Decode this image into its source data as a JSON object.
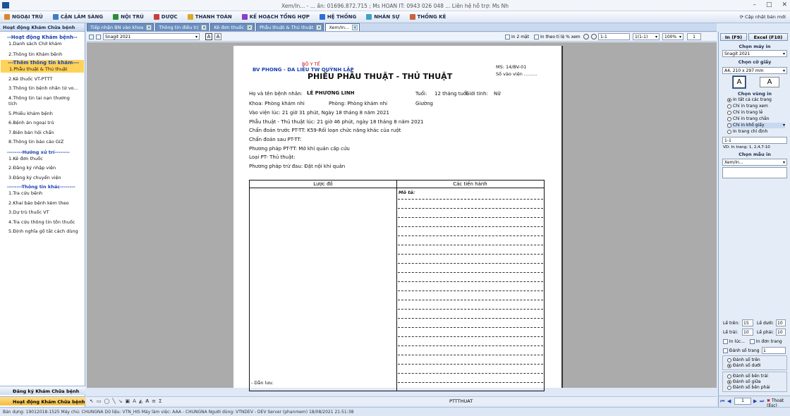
{
  "titlebar": {
    "title": "Xem/In... - ... ần: 01696.872.715 ; Ms HOAN IT: 0943 026 048 ... Liên hệ hỗ trợ: Ms Nh"
  },
  "menu": [
    {
      "label": "NGOẠI TRÚ",
      "color": "#d9862b"
    },
    {
      "label": "CẬN LÂM SÀNG",
      "color": "#3d7cc9"
    },
    {
      "label": "NỘI TRÚ",
      "color": "#2b8c3c"
    },
    {
      "label": "DƯỢC",
      "color": "#c93d3d"
    },
    {
      "label": "THANH TOÁN",
      "color": "#d9a92b"
    },
    {
      "label": "KẾ HOẠCH TỔNG HỢP",
      "color": "#8a3dc9"
    },
    {
      "label": "HỆ THỐNG",
      "color": "#2b6fd9"
    },
    {
      "label": "NHÂN SỰ",
      "color": "#3da0c9"
    },
    {
      "label": "THỐNG KÊ",
      "color": "#c9633d"
    }
  ],
  "menu_right": "Cập nhật bản mới",
  "left": {
    "header": "Hoạt động Khám Chữa bệnh",
    "sec1": "--Hoạt động Khám bệnh--",
    "items1": [
      "1.Danh sách Chờ khám",
      "2.Thông tin Khám bệnh"
    ],
    "sec2": "---Thêm thông tin khám---",
    "sel_item": "1.Phẫu thuật & Thủ thuật",
    "items2": [
      "2.Kê thuốc VT-PTTT",
      "3.Thông tin bệnh nhân tử vo...",
      "4.Thông tin tai nạn thương tích",
      "5.Phiếu khám bệnh",
      "6.Bệnh án ngoại trú",
      "7.Biên bản hội chẩn",
      "8.Thông tin báo cáo GIZ"
    ],
    "sec3": "--------Hướng xử trí--------",
    "items3": [
      "1.Kê đơn thuốc",
      "2.Đăng ký nhập viện",
      "3.Đăng ký chuyển viện"
    ],
    "sec4": "--------Thông tin khác--------",
    "items4": [
      "1.Tra cứu bệnh",
      "2.Khai báo bệnh kèm theo",
      "3.Dự trù thuốc VT",
      "4.Tra cứu thông tin tồn thuốc",
      "5.Định nghĩa gõ tắt cách dùng"
    ],
    "btn1": "Đăng ký Khám Chữa bệnh",
    "btn2": "Hoạt động Khám Chữa bệnh"
  },
  "tabs": [
    "Tiếp nhận BN vào khoa",
    "Thông tin điều trị",
    "Kê đơn thuốc",
    "Phẫu thuật & Thủ thuật",
    "Xem/In..."
  ],
  "toolbar": {
    "printer": "Snagit 2021",
    "two_pages": "In 2 mặt",
    "ratio": "In theo tỉ lệ % xem",
    "range": "1-1",
    "pages": "1(1-1)",
    "zoom": "100%",
    "copies": "1"
  },
  "doc": {
    "ministry": "BỘ Y TẾ",
    "hospital": "BV PHONG - DA LIỄU TW QUỲNH LẬP",
    "title": "PHIẾU PHẪU THUẬT - THỦ THUẬT",
    "form_no": "MS: 14/BV-01",
    "entry_no": "Số vào viện .........",
    "l_name": "Họ và tên bệnh nhân:",
    "v_name": "LÊ PHƯƠNG LINH",
    "l_age": "Tuổi:",
    "v_age": "12 tháng tuổi",
    "l_sex": "Giới tính:",
    "v_sex": "Nữ",
    "l_dept": "Khoa: Phòng khám nhi",
    "l_room": "Phòng: Phòng khám nhi",
    "l_bed": "Giường",
    "admit": "Vào viện lúc:     21 giờ 31 phút, Ngày 18 tháng 8 năm 2021",
    "surg_time": "Phẫu thuật - Thủ thuật lúc:     21 giờ 46 phút, ngày 18 tháng 8 năm 2021",
    "pre_dx": "Chẩn đoán trước PT-TT:   K59-Rối loạn chức năng khác của ruột",
    "post_dx": "Chẩn đoán sau PT-TT:",
    "method": "Phương pháp PT-TT:   Mở khí quản cấp cứu",
    "type": "Loại PT- Thủ thuật:",
    "anesth": "Phương pháp trừ đau:     Đặt nội khí quản",
    "col1": "Lược đồ",
    "col2": "Các tiến hành",
    "desc": "Mô tả:",
    "drain": "- Dẫn lưu:"
  },
  "status_code": "PTTTHUAT",
  "right": {
    "print_btn": "In (F9)",
    "excel_btn": "Excel (F10)",
    "printer_h": "Chọn máy in",
    "printer": "Snagit 2021",
    "paper_h": "Chọn cỡ giấy",
    "paper": "A4, 210 x 297 mm",
    "area_h": "Chọn vùng in",
    "opts": [
      "In tất cả các trang",
      "Chỉ in trang xem",
      "Chỉ in trang lẻ",
      "Chỉ in trang chẵn",
      "Chỉ in khổ giấy",
      "In trang chỉ định"
    ],
    "range": "1-1",
    "example": "VD: In trang: 1, 2,4,7-10",
    "template_h": "Chọn mẫu in",
    "template": "Xem/In...",
    "m_top_l": "Lề trên:",
    "m_top": "15",
    "m_bot_l": "Lề dưới:",
    "m_bot": "10",
    "m_left_l": "Lề trái:",
    "m_left": "10",
    "m_right_l": "Lề phải:",
    "m_right": "10",
    "print_on": "In lúc...",
    "single": "In đơn trang",
    "number_pages": "Đánh số trang",
    "number_start": "1",
    "num_pos": [
      "Đánh số trên",
      "Đánh số dưới"
    ],
    "num_align": [
      "Đánh số bên trái",
      "Đánh số giữa",
      "Đánh số bên phải"
    ],
    "page_now": "1",
    "exit": "Thoát (Esc)"
  },
  "footer": "Bản dựng: 19012018-1525   Máy chủ: CHUNGNA   Dữ liệu: VTN_HIS   Máy làm việc: AAA - CHUNGNA   Người dùng: VTNDEV - DEV Server (phanmem)   18/08/2021 21:51:38"
}
